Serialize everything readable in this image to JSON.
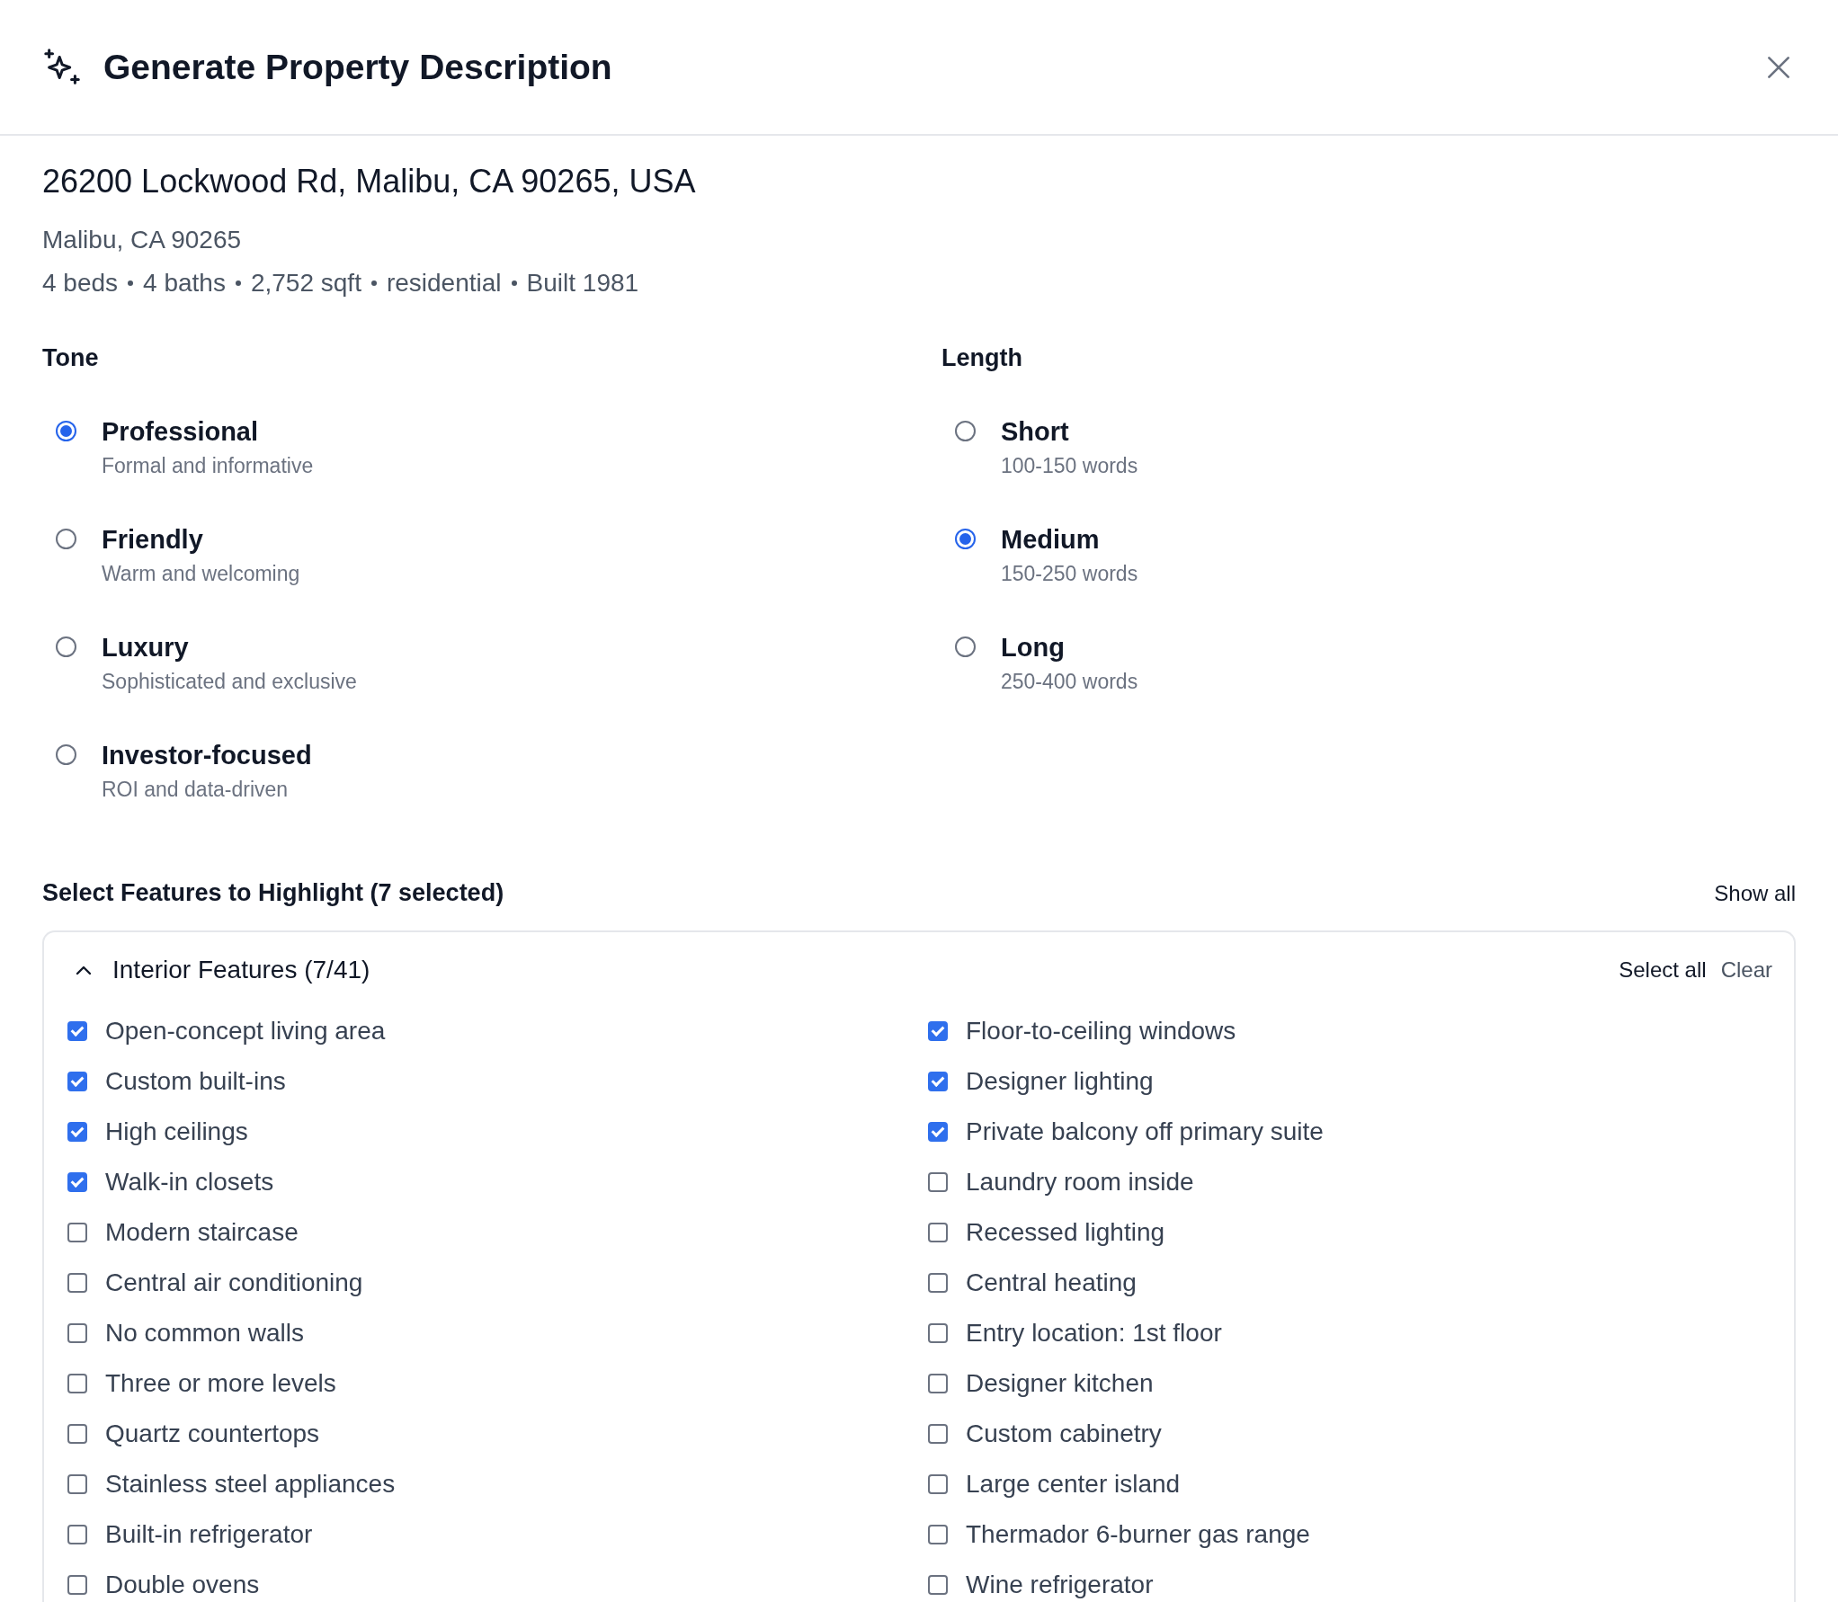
{
  "dialog": {
    "title": "Generate Property Description"
  },
  "property": {
    "address": "26200 Lockwood Rd, Malibu, CA 90265, USA",
    "locality": "Malibu, CA 90265",
    "facts": [
      "4 beds",
      "4 baths",
      "2,752 sqft",
      "residential",
      "Built 1981"
    ]
  },
  "tone": {
    "label": "Tone",
    "options": [
      {
        "title": "Professional",
        "description": "Formal and informative",
        "selected": true
      },
      {
        "title": "Friendly",
        "description": "Warm and welcoming",
        "selected": false
      },
      {
        "title": "Luxury",
        "description": "Sophisticated and exclusive",
        "selected": false
      },
      {
        "title": "Investor-focused",
        "description": "ROI and data-driven",
        "selected": false
      }
    ]
  },
  "length": {
    "label": "Length",
    "options": [
      {
        "title": "Short",
        "description": "100-150 words",
        "selected": false
      },
      {
        "title": "Medium",
        "description": "150-250 words",
        "selected": true
      },
      {
        "title": "Long",
        "description": "250-400 words",
        "selected": false
      }
    ]
  },
  "features": {
    "heading": "Select Features to Highlight (7 selected)",
    "show_all": "Show all",
    "group": {
      "title": "Interior Features (7/41)",
      "expanded": true,
      "select_all": "Select all",
      "clear": "Clear",
      "items": [
        {
          "label": "Open-concept living area",
          "checked": true
        },
        {
          "label": "Floor-to-ceiling windows",
          "checked": true
        },
        {
          "label": "Custom built-ins",
          "checked": true
        },
        {
          "label": "Designer lighting",
          "checked": true
        },
        {
          "label": "High ceilings",
          "checked": true
        },
        {
          "label": "Private balcony off primary suite",
          "checked": true
        },
        {
          "label": "Walk-in closets",
          "checked": true
        },
        {
          "label": "Laundry room inside",
          "checked": false
        },
        {
          "label": "Modern staircase",
          "checked": false
        },
        {
          "label": "Recessed lighting",
          "checked": false
        },
        {
          "label": "Central air conditioning",
          "checked": false
        },
        {
          "label": "Central heating",
          "checked": false
        },
        {
          "label": "No common walls",
          "checked": false
        },
        {
          "label": "Entry location: 1st floor",
          "checked": false
        },
        {
          "label": "Three or more levels",
          "checked": false
        },
        {
          "label": "Designer kitchen",
          "checked": false
        },
        {
          "label": "Quartz countertops",
          "checked": false
        },
        {
          "label": "Custom cabinetry",
          "checked": false
        },
        {
          "label": "Stainless steel appliances",
          "checked": false
        },
        {
          "label": "Large center island",
          "checked": false
        },
        {
          "label": "Built-in refrigerator",
          "checked": false
        },
        {
          "label": "Thermador 6-burner gas range",
          "checked": false
        },
        {
          "label": "Double ovens",
          "checked": false
        },
        {
          "label": "Wine refrigerator",
          "checked": false
        }
      ]
    }
  }
}
